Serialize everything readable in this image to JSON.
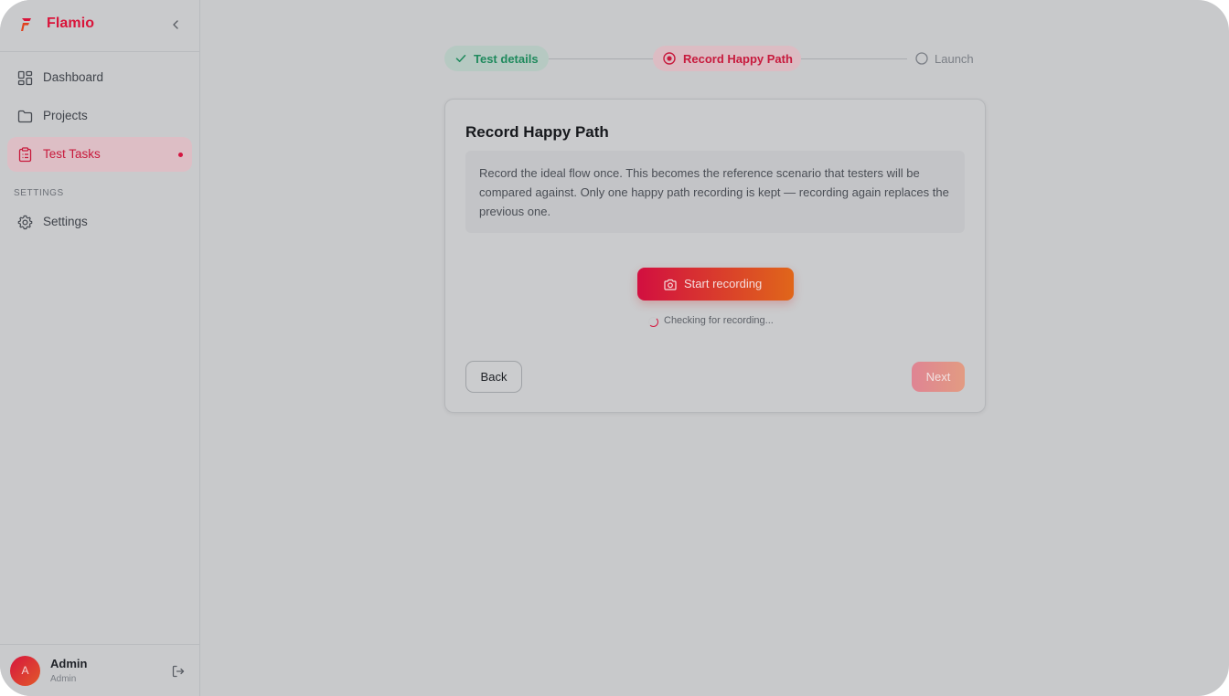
{
  "app": {
    "name": "Flamio"
  },
  "sidebar": {
    "items": [
      {
        "label": "Dashboard",
        "icon": "dashboard-icon"
      },
      {
        "label": "Projects",
        "icon": "folder-icon"
      },
      {
        "label": "Test Tasks",
        "icon": "clipboard-icon",
        "active": true
      }
    ],
    "section_label": "SETTINGS",
    "settings_item": {
      "label": "Settings",
      "icon": "gear-icon"
    },
    "user": {
      "initial": "A",
      "name": "Admin",
      "role": "Admin"
    }
  },
  "stepper": {
    "steps": [
      {
        "label": "Test details",
        "status": "done"
      },
      {
        "label": "Record Happy Path",
        "status": "current"
      },
      {
        "label": "Launch",
        "status": "upcoming"
      }
    ]
  },
  "card": {
    "title": "Record Happy Path",
    "description": "Record the ideal flow once. This becomes the reference scenario that testers will be compared against. Only one happy path recording is kept — recording again replaces the previous one.",
    "record_button": "Start recording",
    "status": "Checking for recording...",
    "back_button": "Back",
    "next_button": "Next"
  },
  "colors": {
    "accent": "#d9143a",
    "gradient_end": "#e0661a",
    "success": "#1f8a5d"
  }
}
